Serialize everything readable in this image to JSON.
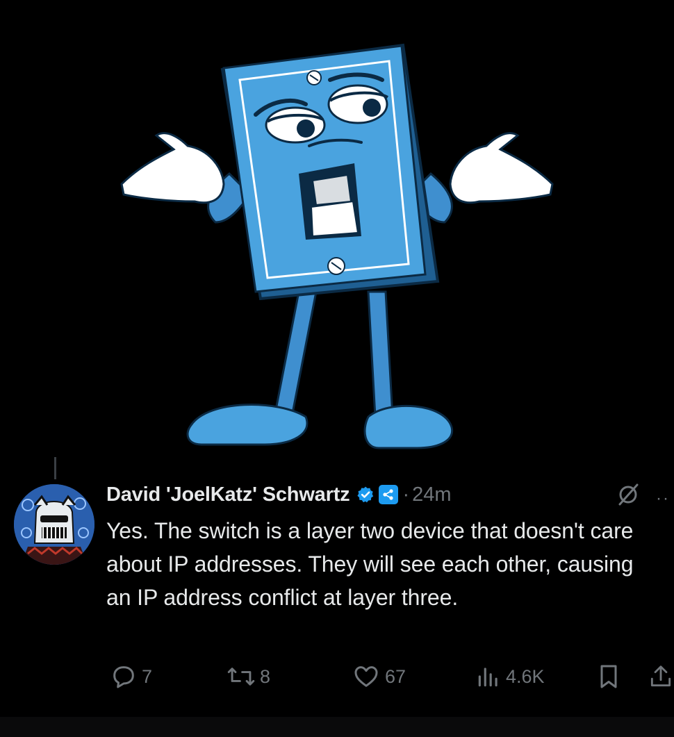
{
  "tweet": {
    "author_name": "David 'JoelKatz' Schwartz",
    "timestamp_separator": "·",
    "timestamp": "24m",
    "text": "Yes. The switch is a layer two device that doesn't care about IP addresses. They will see each other, causing an IP address conflict at layer three."
  },
  "actions": {
    "replies": "7",
    "reposts": "8",
    "likes": "67",
    "views": "4.6K"
  },
  "more_label": "··",
  "colors": {
    "background": "#000000",
    "text": "#e7e9ea",
    "muted": "#71767b",
    "accent": "#1d9bf0",
    "switch_blue": "#4aa3df"
  },
  "icons": [
    "verified-badge-icon",
    "affiliate-badge-icon",
    "grok-icon",
    "more-icon",
    "reply-icon",
    "repost-icon",
    "like-icon",
    "views-icon",
    "bookmark-icon",
    "share-icon"
  ]
}
